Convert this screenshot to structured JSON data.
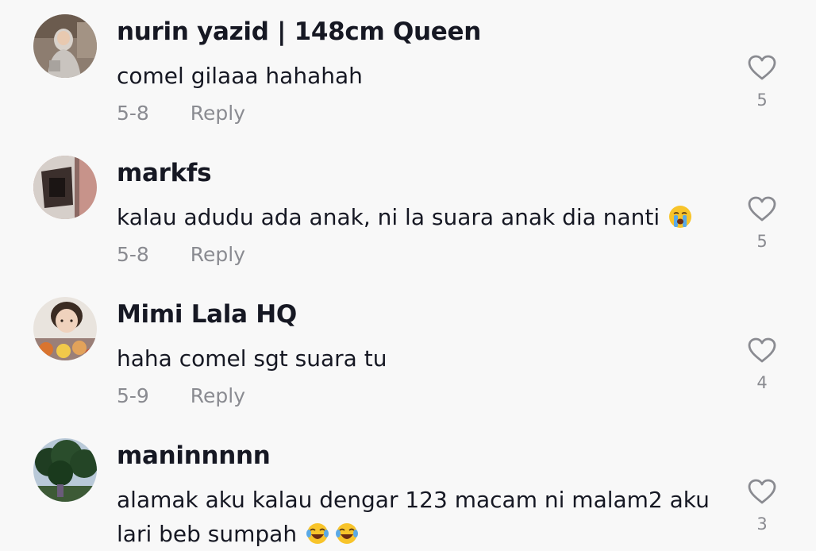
{
  "comments": [
    {
      "username": "nurin yazid | 148cm Queen",
      "text": "comel gilaaa hahahah",
      "date": "5-8",
      "reply_label": "Reply",
      "likes": "5",
      "avatar": "avatar-hijab-woman"
    },
    {
      "username": "markfs",
      "text": "kalau adudu ada anak, ni la suara anak dia nanti",
      "emoji": "loudly-crying-face",
      "date": "5-8",
      "reply_label": "Reply",
      "likes": "5",
      "avatar": "avatar-dark-object"
    },
    {
      "username": "Mimi Lala HQ",
      "text": "haha comel sgt suara tu",
      "date": "5-9",
      "reply_label": "Reply",
      "likes": "4",
      "avatar": "avatar-woman-with-food"
    },
    {
      "username": "maninnnnn",
      "text_line1": "alamak aku kalau dengar 123 macam ni malam2 aku",
      "text_line2": "lari beb sumpah",
      "emoji": "face-with-tears-of-joy",
      "date": "",
      "reply_label": "",
      "likes": "3",
      "avatar": "avatar-trees"
    }
  ],
  "icons": {
    "like": "heart-outline-icon"
  },
  "colors": {
    "background": "#f8f8f8",
    "primary_text": "#161823",
    "secondary_text": "#8a8b91"
  }
}
